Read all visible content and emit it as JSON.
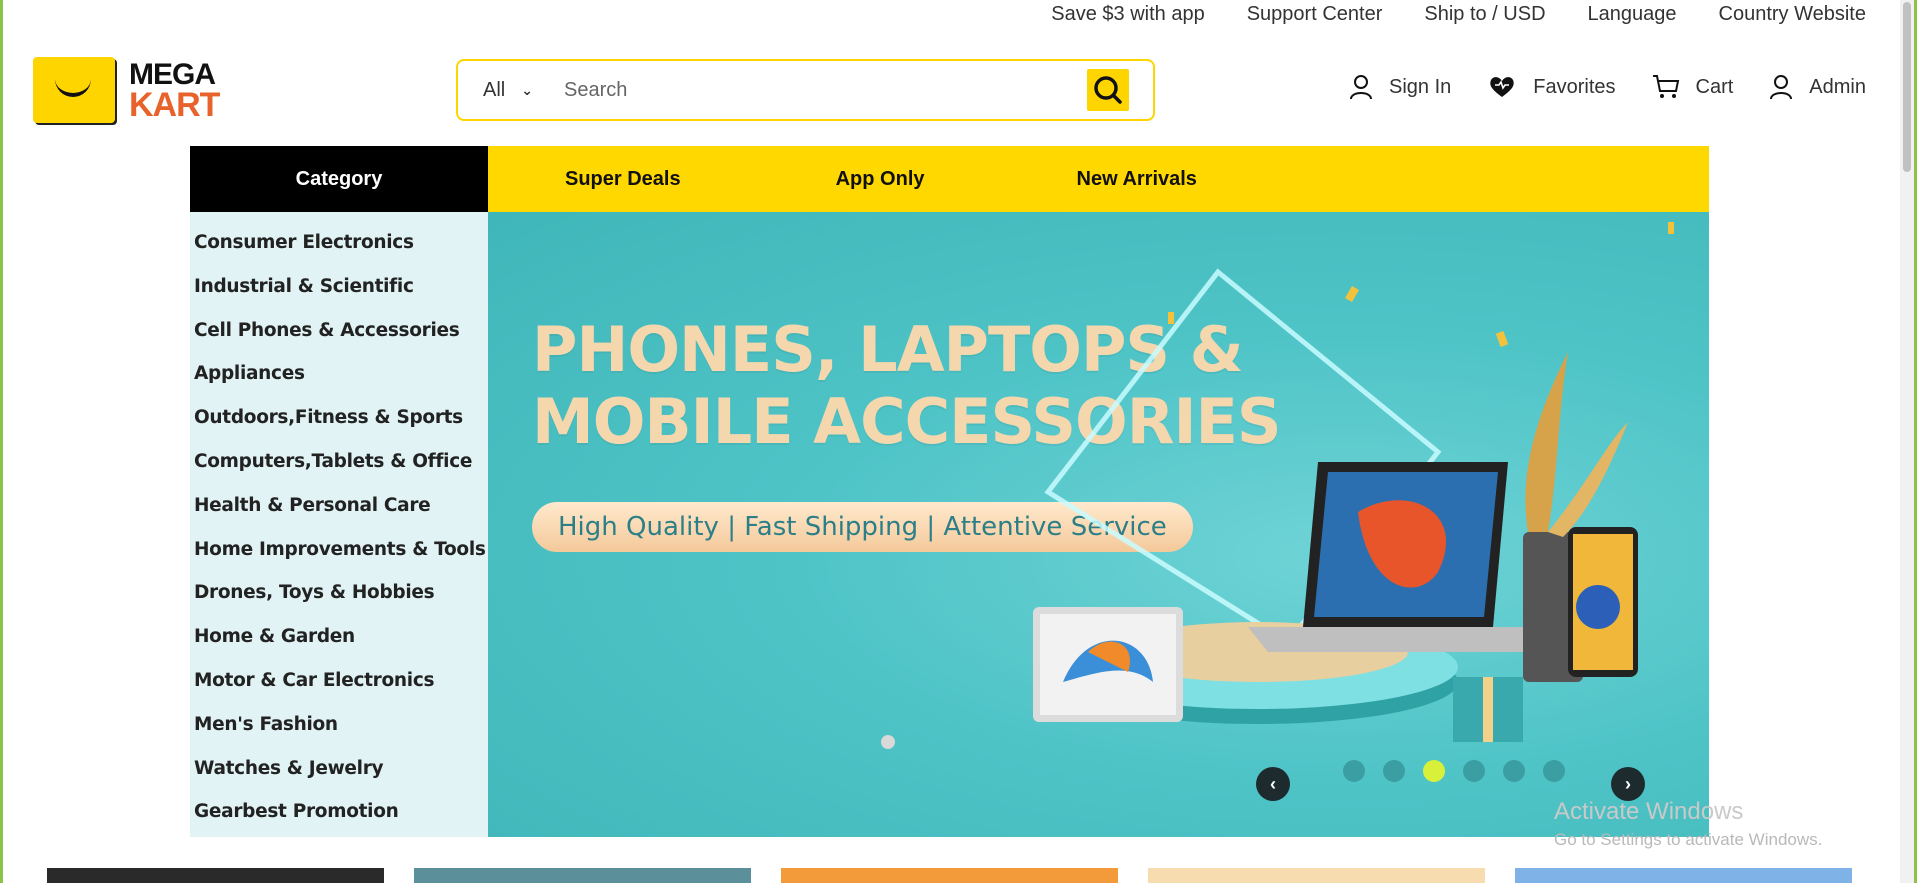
{
  "topbar": {
    "items": [
      "Save $3 with app",
      "Support Center",
      "Ship to / USD",
      "Language",
      "Country Website"
    ]
  },
  "logo": {
    "line1": "MEGA",
    "line2": "KART"
  },
  "search": {
    "scope": "All",
    "placeholder": "Search"
  },
  "actions": {
    "sign_in": "Sign In",
    "favorites": "Favorites",
    "cart": "Cart",
    "admin": "Admin"
  },
  "nav": {
    "category": "Category",
    "items": [
      "Super Deals",
      "App Only",
      "New Arrivals"
    ]
  },
  "categories": [
    "Consumer Electronics",
    "Industrial & Scientific",
    "Cell Phones & Accessories",
    "Appliances",
    "Outdoors,Fitness & Sports",
    "Computers,Tablets & Office",
    "Health & Personal Care",
    "Home Improvements & Tools",
    "Drones, Toys & Hobbies",
    "Home & Garden",
    "Motor & Car Electronics",
    "Men's Fashion",
    "Watches & Jewelry",
    "Gearbest Promotion"
  ],
  "banner": {
    "headline_line1": "PHONES, LAPTOPS &",
    "headline_line2": "MOBILE ACCESSORIES",
    "tagline": "High Quality | Fast Shipping | Attentive Service",
    "slide_count": 6,
    "active_slide": 3
  },
  "watermark": {
    "line1": "Activate Windows",
    "line2": "Go to Settings to activate Windows."
  },
  "colors": {
    "accent": "#ffd800",
    "logo_orange": "#e8632b",
    "sidebar_bg": "#e1f3f4",
    "banner_bg": "#4fc4c7",
    "active_dot": "#d9f03a"
  },
  "tile_colors": [
    "#2a2a2a",
    "#5b8f99",
    "#f39a3a",
    "#f6dcae",
    "#7fb3e8"
  ]
}
